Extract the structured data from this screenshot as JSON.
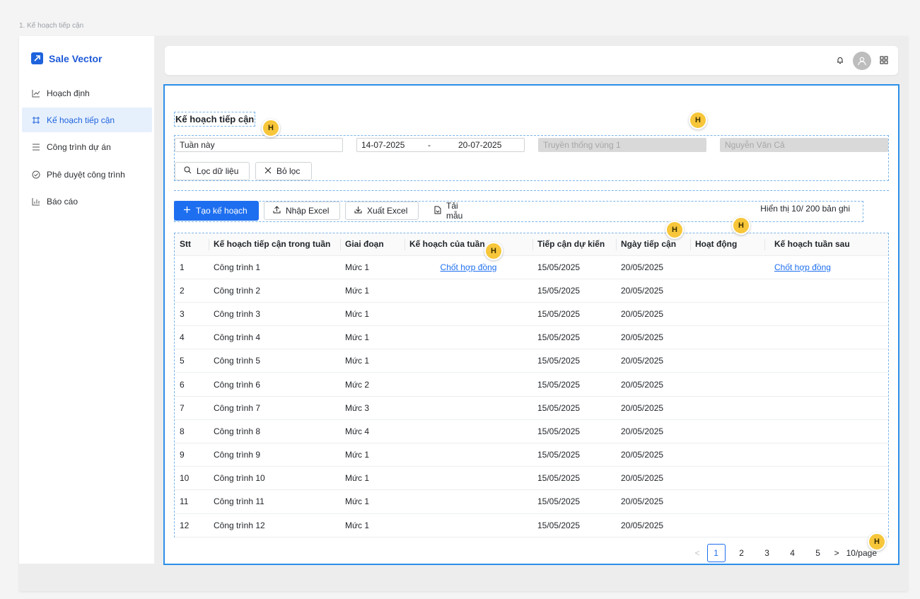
{
  "frame_label": "1. Kế hoạch tiếp cận",
  "brand": {
    "name": "Sale Vector",
    "color": "#1e63dd"
  },
  "nav": [
    {
      "label": "Hoạch định",
      "icon": "line-chart-icon",
      "active": false
    },
    {
      "label": "Kế hoạch tiếp cận",
      "icon": "route-icon",
      "active": true
    },
    {
      "label": "Công trình dự án",
      "icon": "list-icon",
      "active": false
    },
    {
      "label": "Phê duyệt công trình",
      "icon": "check-circle-icon",
      "active": false
    },
    {
      "label": "Báo cáo",
      "icon": "bar-chart-icon",
      "active": false
    }
  ],
  "page": {
    "title": "Kế hoạch tiếp cận"
  },
  "filters": {
    "period": "Tuần này",
    "date_from": "14-07-2025",
    "date_sep": "-",
    "date_to": "20-07-2025",
    "region": "Truyền thống vùng 1",
    "staff": "Nguyễn Văn Cả",
    "filter_button": "Lọc dữ liệu",
    "clear_button": "Bỏ lọc"
  },
  "toolbar": {
    "create": "Tạo kế hoạch",
    "import": "Nhập Excel",
    "export": "Xuất Excel",
    "template": "Tải mẫu",
    "count": "Hiển thị 10/ 200 bản ghi"
  },
  "table": {
    "headers": [
      "Stt",
      "Kế hoạch tiếp cận trong tuần",
      "Giai đoạn",
      "Kế hoạch của tuần",
      "Tiếp cận dự kiến",
      "Ngày tiếp cận",
      "Hoạt động",
      "Kế hoạch tuần sau"
    ],
    "rows": [
      [
        "1",
        "Công trình 1",
        "Mức 1",
        "Chốt hợp đồng",
        "15/05/2025",
        "20/05/2025",
        "",
        "Chốt hợp đồng"
      ],
      [
        "2",
        "Công trình 2",
        "Mức 1",
        "",
        "15/05/2025",
        "20/05/2025",
        "",
        ""
      ],
      [
        "3",
        "Công trình 3",
        "Mức 1",
        "",
        "15/05/2025",
        "20/05/2025",
        "",
        ""
      ],
      [
        "4",
        "Công trình 4",
        "Mức 1",
        "",
        "15/05/2025",
        "20/05/2025",
        "",
        ""
      ],
      [
        "5",
        "Công trình 5",
        "Mức 1",
        "",
        "15/05/2025",
        "20/05/2025",
        "",
        ""
      ],
      [
        "6",
        "Công trình 6",
        "Mức 2",
        "",
        "15/05/2025",
        "20/05/2025",
        "",
        ""
      ],
      [
        "7",
        "Công trình 7",
        "Mức 3",
        "",
        "15/05/2025",
        "20/05/2025",
        "",
        ""
      ],
      [
        "8",
        "Công trình 8",
        "Mức 4",
        "",
        "15/05/2025",
        "20/05/2025",
        "",
        ""
      ],
      [
        "9",
        "Công trình 9",
        "Mức 1",
        "",
        "15/05/2025",
        "20/05/2025",
        "",
        ""
      ],
      [
        "10",
        "Công trình 10",
        "Mức 1",
        "",
        "15/05/2025",
        "20/05/2025",
        "",
        ""
      ],
      [
        "11",
        "Công trình 11",
        "Mức 1",
        "",
        "15/05/2025",
        "20/05/2025",
        "",
        ""
      ],
      [
        "12",
        "Công trình 12",
        "Mức 1",
        "",
        "15/05/2025",
        "20/05/2025",
        "",
        ""
      ]
    ]
  },
  "pagination": {
    "prev": "<",
    "pages": [
      "1",
      "2",
      "3",
      "4",
      "5"
    ],
    "current": "1",
    "next": ">",
    "page_size": "10/page"
  },
  "annotation_marker": "H"
}
